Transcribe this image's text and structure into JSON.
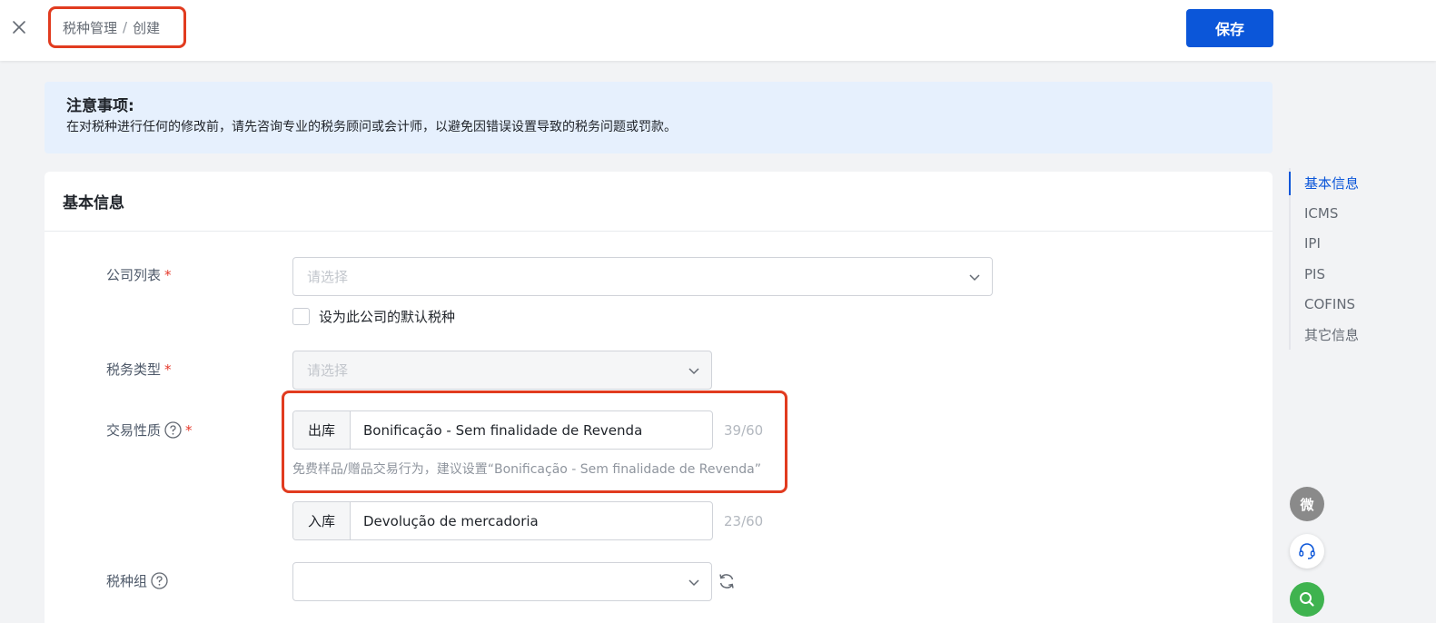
{
  "header": {
    "breadcrumb_parent": "税种管理",
    "breadcrumb_separator": "/",
    "breadcrumb_current": "创建",
    "save_label": "保存"
  },
  "notice": {
    "title": "注意事项:",
    "text": "在对税种进行任何的修改前，请先咨询专业的税务顾问或会计师，以避免因错误设置导致的税务问题或罚款。"
  },
  "section": {
    "title": "基本信息"
  },
  "form": {
    "company": {
      "label": "公司列表",
      "required_mark": "*",
      "placeholder": "请选择",
      "default_checkbox_label": "设为此公司的默认税种",
      "default_checked": false
    },
    "tax_type": {
      "label": "税务类型",
      "required_mark": "*",
      "placeholder": "请选择",
      "disabled": true
    },
    "transaction_nature": {
      "label": "交易性质",
      "required_mark": "*",
      "outbound": {
        "addon": "出库",
        "value": "Bonificação - Sem finalidade de Revenda",
        "counter": "39/60",
        "hint": "免费样品/赠品交易行为，建议设置“Bonificação - Sem finalidade de Revenda”"
      },
      "inbound": {
        "addon": "入库",
        "value": "Devolução de mercadoria",
        "counter": "23/60"
      }
    },
    "tax_group": {
      "label": "税种组",
      "value": ""
    }
  },
  "anchor_nav": {
    "items": [
      {
        "label": "基本信息",
        "active": true
      },
      {
        "label": "ICMS",
        "active": false
      },
      {
        "label": "IPI",
        "active": false
      },
      {
        "label": "PIS",
        "active": false
      },
      {
        "label": "COFINS",
        "active": false
      },
      {
        "label": "其它信息",
        "active": false
      }
    ]
  },
  "floating": {
    "wechat_label": "微",
    "icons": [
      "wechat-icon",
      "headset-icon",
      "search-icon"
    ]
  },
  "colors": {
    "primary": "#0b56d9",
    "highlight_border": "#e13b1f",
    "notice_bg": "#e6f0fd",
    "required": "#e5392b",
    "search_green": "#3fb34f"
  }
}
